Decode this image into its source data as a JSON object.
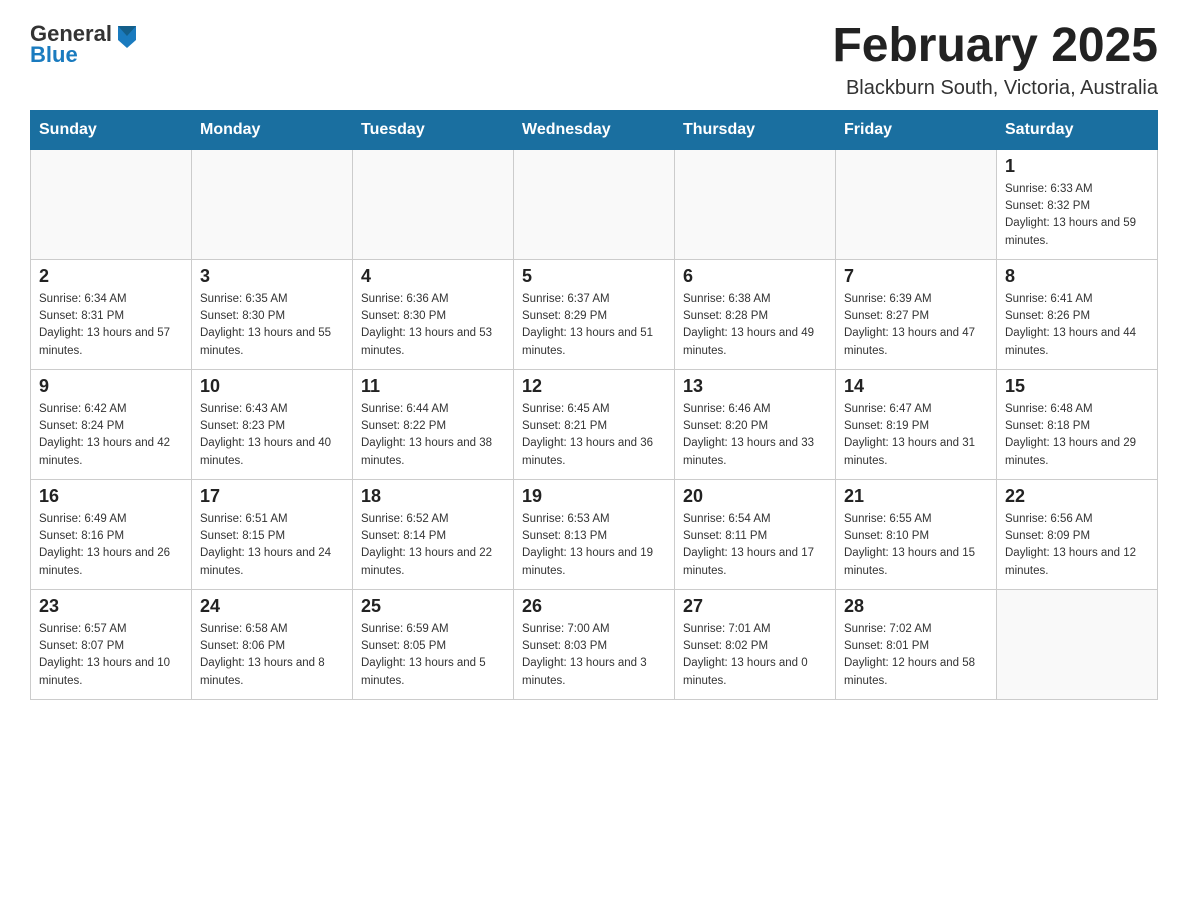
{
  "header": {
    "logo": {
      "text_general": "General",
      "text_blue": "Blue",
      "arrow_color": "#1a7bbf"
    },
    "title": "February 2025",
    "location": "Blackburn South, Victoria, Australia"
  },
  "days_of_week": [
    "Sunday",
    "Monday",
    "Tuesday",
    "Wednesday",
    "Thursday",
    "Friday",
    "Saturday"
  ],
  "weeks": [
    [
      {
        "day": "",
        "sunrise": "",
        "sunset": "",
        "daylight": ""
      },
      {
        "day": "",
        "sunrise": "",
        "sunset": "",
        "daylight": ""
      },
      {
        "day": "",
        "sunrise": "",
        "sunset": "",
        "daylight": ""
      },
      {
        "day": "",
        "sunrise": "",
        "sunset": "",
        "daylight": ""
      },
      {
        "day": "",
        "sunrise": "",
        "sunset": "",
        "daylight": ""
      },
      {
        "day": "",
        "sunrise": "",
        "sunset": "",
        "daylight": ""
      },
      {
        "day": "1",
        "sunrise": "Sunrise: 6:33 AM",
        "sunset": "Sunset: 8:32 PM",
        "daylight": "Daylight: 13 hours and 59 minutes."
      }
    ],
    [
      {
        "day": "2",
        "sunrise": "Sunrise: 6:34 AM",
        "sunset": "Sunset: 8:31 PM",
        "daylight": "Daylight: 13 hours and 57 minutes."
      },
      {
        "day": "3",
        "sunrise": "Sunrise: 6:35 AM",
        "sunset": "Sunset: 8:30 PM",
        "daylight": "Daylight: 13 hours and 55 minutes."
      },
      {
        "day": "4",
        "sunrise": "Sunrise: 6:36 AM",
        "sunset": "Sunset: 8:30 PM",
        "daylight": "Daylight: 13 hours and 53 minutes."
      },
      {
        "day": "5",
        "sunrise": "Sunrise: 6:37 AM",
        "sunset": "Sunset: 8:29 PM",
        "daylight": "Daylight: 13 hours and 51 minutes."
      },
      {
        "day": "6",
        "sunrise": "Sunrise: 6:38 AM",
        "sunset": "Sunset: 8:28 PM",
        "daylight": "Daylight: 13 hours and 49 minutes."
      },
      {
        "day": "7",
        "sunrise": "Sunrise: 6:39 AM",
        "sunset": "Sunset: 8:27 PM",
        "daylight": "Daylight: 13 hours and 47 minutes."
      },
      {
        "day": "8",
        "sunrise": "Sunrise: 6:41 AM",
        "sunset": "Sunset: 8:26 PM",
        "daylight": "Daylight: 13 hours and 44 minutes."
      }
    ],
    [
      {
        "day": "9",
        "sunrise": "Sunrise: 6:42 AM",
        "sunset": "Sunset: 8:24 PM",
        "daylight": "Daylight: 13 hours and 42 minutes."
      },
      {
        "day": "10",
        "sunrise": "Sunrise: 6:43 AM",
        "sunset": "Sunset: 8:23 PM",
        "daylight": "Daylight: 13 hours and 40 minutes."
      },
      {
        "day": "11",
        "sunrise": "Sunrise: 6:44 AM",
        "sunset": "Sunset: 8:22 PM",
        "daylight": "Daylight: 13 hours and 38 minutes."
      },
      {
        "day": "12",
        "sunrise": "Sunrise: 6:45 AM",
        "sunset": "Sunset: 8:21 PM",
        "daylight": "Daylight: 13 hours and 36 minutes."
      },
      {
        "day": "13",
        "sunrise": "Sunrise: 6:46 AM",
        "sunset": "Sunset: 8:20 PM",
        "daylight": "Daylight: 13 hours and 33 minutes."
      },
      {
        "day": "14",
        "sunrise": "Sunrise: 6:47 AM",
        "sunset": "Sunset: 8:19 PM",
        "daylight": "Daylight: 13 hours and 31 minutes."
      },
      {
        "day": "15",
        "sunrise": "Sunrise: 6:48 AM",
        "sunset": "Sunset: 8:18 PM",
        "daylight": "Daylight: 13 hours and 29 minutes."
      }
    ],
    [
      {
        "day": "16",
        "sunrise": "Sunrise: 6:49 AM",
        "sunset": "Sunset: 8:16 PM",
        "daylight": "Daylight: 13 hours and 26 minutes."
      },
      {
        "day": "17",
        "sunrise": "Sunrise: 6:51 AM",
        "sunset": "Sunset: 8:15 PM",
        "daylight": "Daylight: 13 hours and 24 minutes."
      },
      {
        "day": "18",
        "sunrise": "Sunrise: 6:52 AM",
        "sunset": "Sunset: 8:14 PM",
        "daylight": "Daylight: 13 hours and 22 minutes."
      },
      {
        "day": "19",
        "sunrise": "Sunrise: 6:53 AM",
        "sunset": "Sunset: 8:13 PM",
        "daylight": "Daylight: 13 hours and 19 minutes."
      },
      {
        "day": "20",
        "sunrise": "Sunrise: 6:54 AM",
        "sunset": "Sunset: 8:11 PM",
        "daylight": "Daylight: 13 hours and 17 minutes."
      },
      {
        "day": "21",
        "sunrise": "Sunrise: 6:55 AM",
        "sunset": "Sunset: 8:10 PM",
        "daylight": "Daylight: 13 hours and 15 minutes."
      },
      {
        "day": "22",
        "sunrise": "Sunrise: 6:56 AM",
        "sunset": "Sunset: 8:09 PM",
        "daylight": "Daylight: 13 hours and 12 minutes."
      }
    ],
    [
      {
        "day": "23",
        "sunrise": "Sunrise: 6:57 AM",
        "sunset": "Sunset: 8:07 PM",
        "daylight": "Daylight: 13 hours and 10 minutes."
      },
      {
        "day": "24",
        "sunrise": "Sunrise: 6:58 AM",
        "sunset": "Sunset: 8:06 PM",
        "daylight": "Daylight: 13 hours and 8 minutes."
      },
      {
        "day": "25",
        "sunrise": "Sunrise: 6:59 AM",
        "sunset": "Sunset: 8:05 PM",
        "daylight": "Daylight: 13 hours and 5 minutes."
      },
      {
        "day": "26",
        "sunrise": "Sunrise: 7:00 AM",
        "sunset": "Sunset: 8:03 PM",
        "daylight": "Daylight: 13 hours and 3 minutes."
      },
      {
        "day": "27",
        "sunrise": "Sunrise: 7:01 AM",
        "sunset": "Sunset: 8:02 PM",
        "daylight": "Daylight: 13 hours and 0 minutes."
      },
      {
        "day": "28",
        "sunrise": "Sunrise: 7:02 AM",
        "sunset": "Sunset: 8:01 PM",
        "daylight": "Daylight: 12 hours and 58 minutes."
      },
      {
        "day": "",
        "sunrise": "",
        "sunset": "",
        "daylight": ""
      }
    ]
  ]
}
